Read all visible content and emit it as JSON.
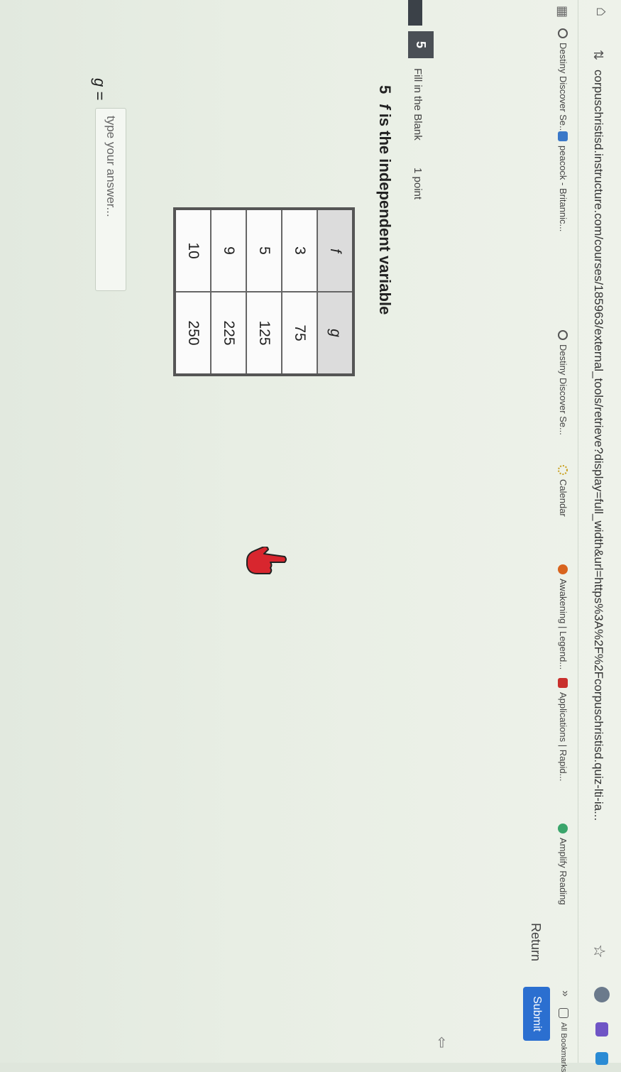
{
  "browser": {
    "url": "corpuschristisd.instructure.com/courses/185963/external_tools/retrieve?display=full_width&url=https%3A%2F%2Fcorpuschristisd.quiz-lti-ia..."
  },
  "bookmarks": [
    {
      "label": "Destiny Discover Se..."
    },
    {
      "label": "peacock - Britannic..."
    },
    {
      "label": "Destiny Discover Se..."
    },
    {
      "label": "Calendar"
    },
    {
      "label": "Awakening | Legend..."
    },
    {
      "label": "Applications | Rapid..."
    },
    {
      "label": "Amplify Reading"
    },
    {
      "label": "All Bookmarks"
    }
  ],
  "actions": {
    "return_label": "Return",
    "submit_label": "Submit"
  },
  "question": {
    "number": "5",
    "type": "Fill in the Blank",
    "points": "1 point",
    "title_number": "5",
    "variable": "f",
    "title_text": " is the independent variable",
    "table": {
      "headers": [
        "f",
        "g"
      ],
      "rows": [
        [
          "3",
          "75"
        ],
        [
          "5",
          "125"
        ],
        [
          "9",
          "225"
        ],
        [
          "10",
          "250"
        ]
      ]
    },
    "answer_label": "g =",
    "answer_placeholder": "type your answer..."
  }
}
